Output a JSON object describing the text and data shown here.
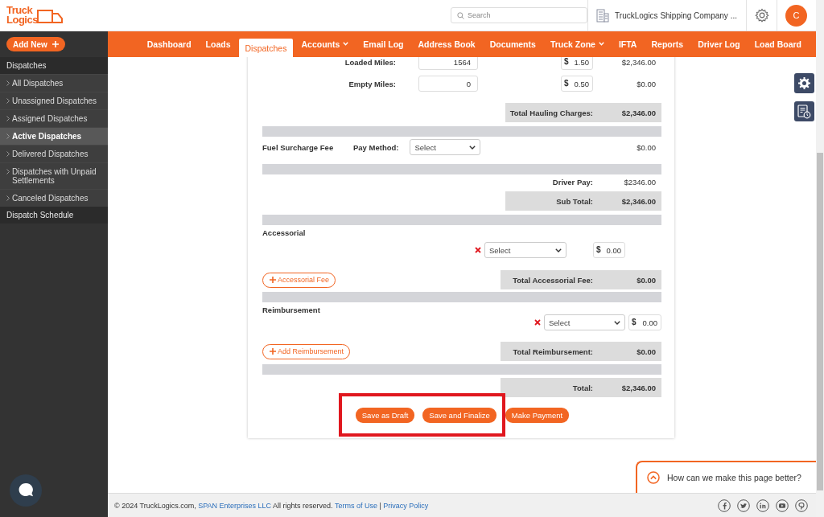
{
  "logo": {
    "line1": "Truck",
    "line2": "Logics"
  },
  "header": {
    "search": {
      "placeholder": "Search"
    },
    "company": "TruckLogics Shipping Company ...",
    "avatar": "C"
  },
  "sidebar": {
    "add_button": "Add New",
    "section": "Dispatches",
    "items": [
      {
        "label": "All Dispatches",
        "selected": false
      },
      {
        "label": "Unassigned Dispatches",
        "selected": false
      },
      {
        "label": "Assigned Dispatches",
        "selected": false
      },
      {
        "label": "Active Dispatches",
        "selected": true
      },
      {
        "label": "Delivered Dispatches",
        "selected": false
      },
      {
        "label": "Dispatches with Unpaid Settlements",
        "selected": false
      },
      {
        "label": "Canceled Dispatches",
        "selected": false
      }
    ],
    "section_2": "Dispatch Schedule"
  },
  "tabs": [
    {
      "label": "Dashboard",
      "selected": false,
      "has_menu": false
    },
    {
      "label": "Loads",
      "selected": false,
      "has_menu": false
    },
    {
      "label": "Dispatches",
      "selected": true,
      "has_menu": false
    },
    {
      "label": "Accounts",
      "selected": false,
      "has_menu": true
    },
    {
      "label": "Email Log",
      "selected": false,
      "has_menu": false
    },
    {
      "label": "Address Book",
      "selected": false,
      "has_menu": false
    },
    {
      "label": "Documents",
      "selected": false,
      "has_menu": false
    },
    {
      "label": "Truck Zone",
      "selected": false,
      "has_menu": true
    },
    {
      "label": "IFTA",
      "selected": false,
      "has_menu": false
    },
    {
      "label": "Reports",
      "selected": false,
      "has_menu": false
    },
    {
      "label": "Driver Log",
      "selected": false,
      "has_menu": false
    },
    {
      "label": "Load Board",
      "selected": false,
      "has_menu": false
    }
  ],
  "charges": {
    "miles_rows": [
      {
        "label": "Loaded Miles:",
        "value": "1564",
        "currency": "$",
        "rate": "1.50",
        "amount": "$2,346.00"
      },
      {
        "label": "Empty Miles:",
        "value": "0",
        "currency": "$",
        "rate": "0.50",
        "amount": "$0.00"
      }
    ],
    "hauling_total": {
      "label": "Total Hauling Charges:",
      "value": "$2,346.00"
    },
    "fuel_surcharge": {
      "label": "Fuel Surcharge Fee",
      "pay_method_label": "Pay Method:",
      "select": "Select",
      "amount": "$0.00"
    },
    "driver_pay": {
      "label": "Driver Pay:",
      "value": "$2346.00"
    },
    "sub_total": {
      "label": "Sub Total:",
      "value": "$2,346.00"
    },
    "accessorial": {
      "title": "Accessorial",
      "select": "Select",
      "currency": "$",
      "amount": "0.00",
      "add_button": "Accessorial Fee",
      "total": {
        "label": "Total Accessorial Fee:",
        "value": "$0.00"
      }
    },
    "reimbursement": {
      "title": "Reimbursement",
      "select": "Select",
      "currency": "$",
      "amount": "0.00",
      "add_button": "Add Reimbursement",
      "total": {
        "label": "Total Reimbursement:",
        "value": "$0.00"
      }
    },
    "total": {
      "label": "Total:",
      "value": "$2,346.00"
    }
  },
  "actions": [
    {
      "label": "Save as Draft",
      "highlighted": true
    },
    {
      "label": "Save and Finalize",
      "highlighted": true
    },
    {
      "label": "Make Payment",
      "highlighted": false
    }
  ],
  "feedback": {
    "label": "How can we make this page better?"
  },
  "footer": {
    "copyright": "© 2024 TruckLogics.com,",
    "company_link": "SPAN Enterprises LLC",
    "rights": "All rights reserved.",
    "terms_link": "Terms of Use",
    "separator": "|",
    "privacy_link": "Privacy Policy"
  }
}
